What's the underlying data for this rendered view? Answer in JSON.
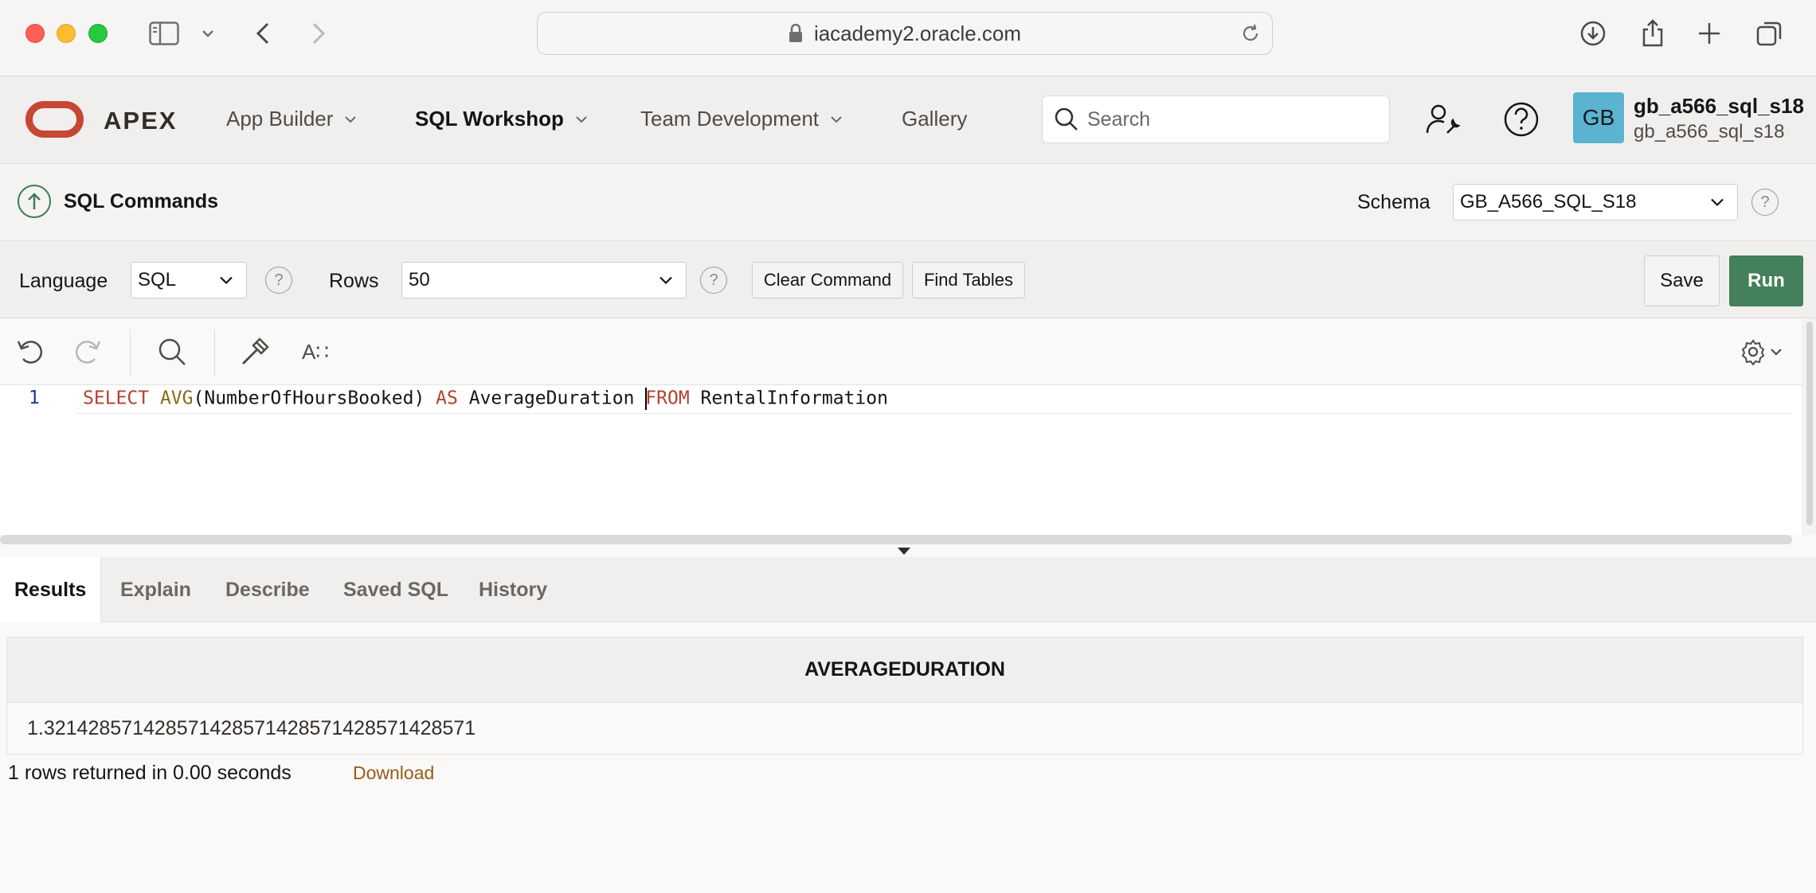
{
  "browser": {
    "url": "iacademy2.oracle.com"
  },
  "header": {
    "brand": "APEX",
    "nav": [
      {
        "label": "App Builder"
      },
      {
        "label": "SQL Workshop"
      },
      {
        "label": "Team Development"
      },
      {
        "label": "Gallery"
      }
    ],
    "search_placeholder": "Search",
    "avatar_initials": "GB",
    "user_name": "gb_a566_sql_s18",
    "user_workspace": "gb_a566_sql_s18"
  },
  "titlebar": {
    "title": "SQL Commands",
    "schema_label": "Schema",
    "schema_value": "GB_A566_SQL_S18"
  },
  "toolbar": {
    "language_label": "Language",
    "language_value": "SQL",
    "rows_label": "Rows",
    "rows_value": "50",
    "clear_label": "Clear Command",
    "find_tables_label": "Find Tables",
    "save_label": "Save",
    "run_label": "Run",
    "help_glyph": "?"
  },
  "editor": {
    "line_number": "1",
    "tokens": {
      "select": "SELECT",
      "avg": "AVG",
      "args": "(NumberOfHoursBooked)",
      "as": "AS",
      "alias": "AverageDuration",
      "from": "FROM",
      "table": "RentalInformation"
    },
    "format_glyph": "A∷"
  },
  "tabs": [
    {
      "label": "Results",
      "active": true
    },
    {
      "label": "Explain"
    },
    {
      "label": "Describe"
    },
    {
      "label": "Saved SQL"
    },
    {
      "label": "History"
    }
  ],
  "results": {
    "column": "AVERAGEDURATION",
    "rows": [
      "1.321428571428571428571428571428571428571"
    ],
    "status": "1 rows returned in 0.00 seconds",
    "download_label": "Download"
  },
  "colors": {
    "run_button": "#44805a",
    "brand_red": "#c74634",
    "keyword": "#b3412d",
    "avatar": "#5ab4d1"
  }
}
